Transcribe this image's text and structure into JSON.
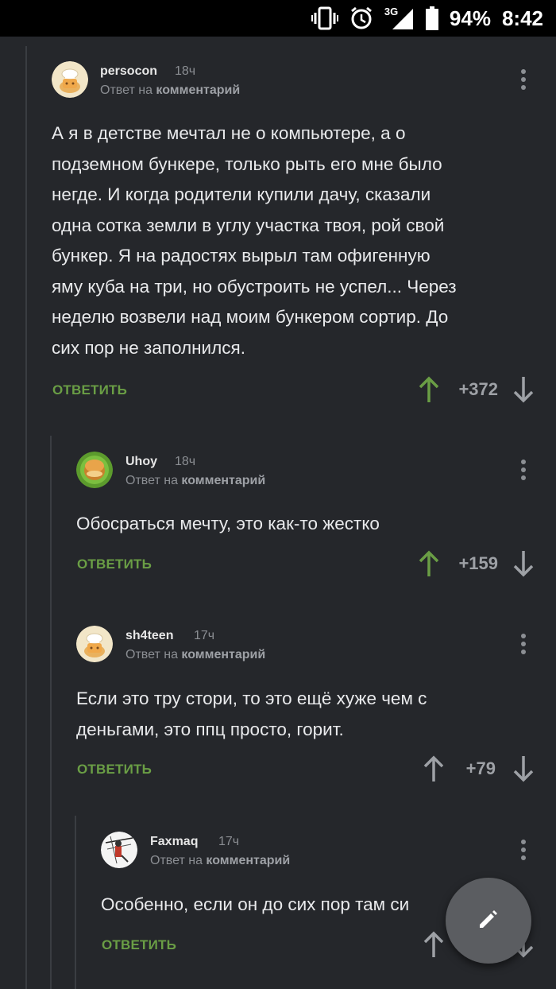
{
  "status_bar": {
    "network": "3G",
    "battery": "94%",
    "time": "8:42"
  },
  "comments": [
    {
      "username": "persocon",
      "time": "18ч",
      "reply_prefix": "Ответ на",
      "reply_target": "комментарий",
      "lines": [
        "А я в детстве мечтал не о компьютере, а о",
        "подземном бункере, только рыть его мне было",
        "негде. И когда родители купили дачу, сказали",
        "одна сотка земли в углу участка твоя, рой свой",
        "бункер. Я на радостях вырыл там офигенную",
        "яму куба на три, но обустроить не успел... Через",
        "неделю возвели над моим бункером сортир. До",
        "сих пор не заполнился."
      ],
      "reply_label": "ОТВЕТИТЬ",
      "score": "+372"
    },
    {
      "username": "Uhoy",
      "time": "18ч",
      "reply_prefix": "Ответ на",
      "reply_target": "комментарий",
      "lines": [
        "Обосраться мечту, это как-то жестко"
      ],
      "reply_label": "ОТВЕТИТЬ",
      "score": "+159"
    },
    {
      "username": "sh4teen",
      "time": "17ч",
      "reply_prefix": "Ответ на",
      "reply_target": "комментарий",
      "lines": [
        "Если это тру стори, то это ещё хуже чем с",
        "деньгами, это ппц просто, горит."
      ],
      "reply_label": "ОТВЕТИТЬ",
      "score": "+79"
    },
    {
      "username": "Faxmaq",
      "time": "17ч",
      "reply_prefix": "Ответ на",
      "reply_target": "комментарий",
      "lines": [
        "Особенно, если он до сих пор там си"
      ],
      "reply_label": "ОТВЕТИТЬ",
      "score": ""
    }
  ],
  "colors": {
    "background": "#25272b",
    "reply_green": "#6a9e45",
    "upvoted_green": "#6a9e45",
    "neutral_gray": "#9ea1a6",
    "fab": "#5b5d61"
  },
  "icons": {
    "status": [
      "vibrate-icon",
      "alarm-icon",
      "signal-icon",
      "battery-icon"
    ],
    "comment": [
      "upvote-arrow-icon",
      "downvote-arrow-icon",
      "more-menu-icon"
    ],
    "fab": "pencil-icon"
  }
}
